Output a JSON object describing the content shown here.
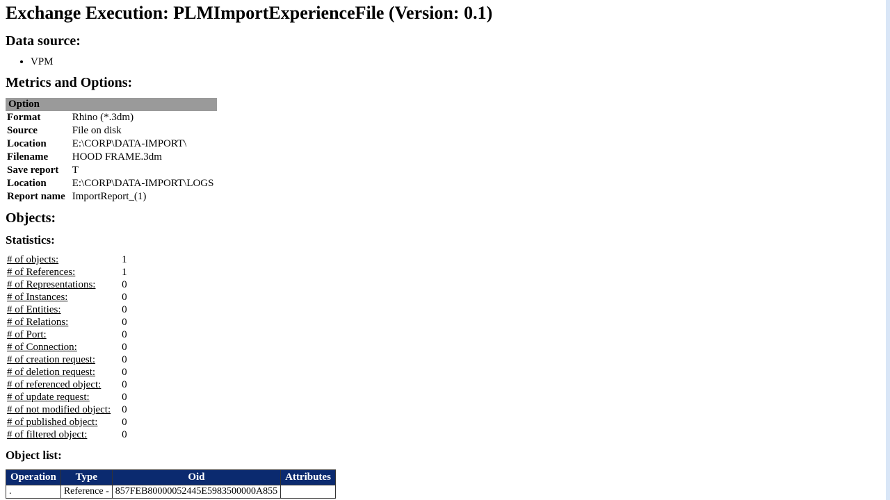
{
  "title": "Exchange Execution: PLMImportExperienceFile (Version: 0.1)",
  "data_source": {
    "heading": "Data source:",
    "items": [
      "VPM"
    ]
  },
  "metrics": {
    "heading": "Metrics and Options:",
    "header": "Option",
    "rows": [
      {
        "label": "Format",
        "value": "Rhino (*.3dm)"
      },
      {
        "label": "Source",
        "value": "File on disk"
      },
      {
        "label": "Location",
        "value": "E:\\CORP\\DATA-IMPORT\\"
      },
      {
        "label": "Filename",
        "value": "HOOD FRAME.3dm"
      },
      {
        "label": "Save report",
        "value": "T"
      },
      {
        "label": "Location",
        "value": "E:\\CORP\\DATA-IMPORT\\LOGS"
      },
      {
        "label": "Report name",
        "value": "ImportReport_(1)"
      }
    ]
  },
  "objects": {
    "heading": "Objects:",
    "statistics": {
      "heading": "Statistics:",
      "rows": [
        {
          "label": "# of objects:",
          "value": "1"
        },
        {
          "label": "# of References:",
          "value": "1"
        },
        {
          "label": "# of Representations:",
          "value": "0"
        },
        {
          "label": "# of Instances:",
          "value": "0"
        },
        {
          "label": "# of Entities:",
          "value": "0"
        },
        {
          "label": "# of Relations:",
          "value": "0"
        },
        {
          "label": "# of Port:",
          "value": "0"
        },
        {
          "label": "# of Connection:",
          "value": "0"
        },
        {
          "label": "# of creation request:",
          "value": "0"
        },
        {
          "label": "# of deletion request:",
          "value": "0"
        },
        {
          "label": "# of referenced object:",
          "value": "0"
        },
        {
          "label": "# of update request:",
          "value": "0"
        },
        {
          "label": "# of not modified object:",
          "value": "0"
        },
        {
          "label": "# of published object:",
          "value": "0"
        },
        {
          "label": "# of filtered object:",
          "value": "0"
        }
      ]
    },
    "object_list": {
      "heading": "Object list:",
      "columns": [
        "Operation",
        "Type",
        "Oid",
        "Attributes"
      ],
      "rows": [
        {
          "operation": ".",
          "type": "Reference -",
          "oid": "857FEB80000052445E5983500000A855",
          "attributes": ""
        }
      ]
    }
  }
}
